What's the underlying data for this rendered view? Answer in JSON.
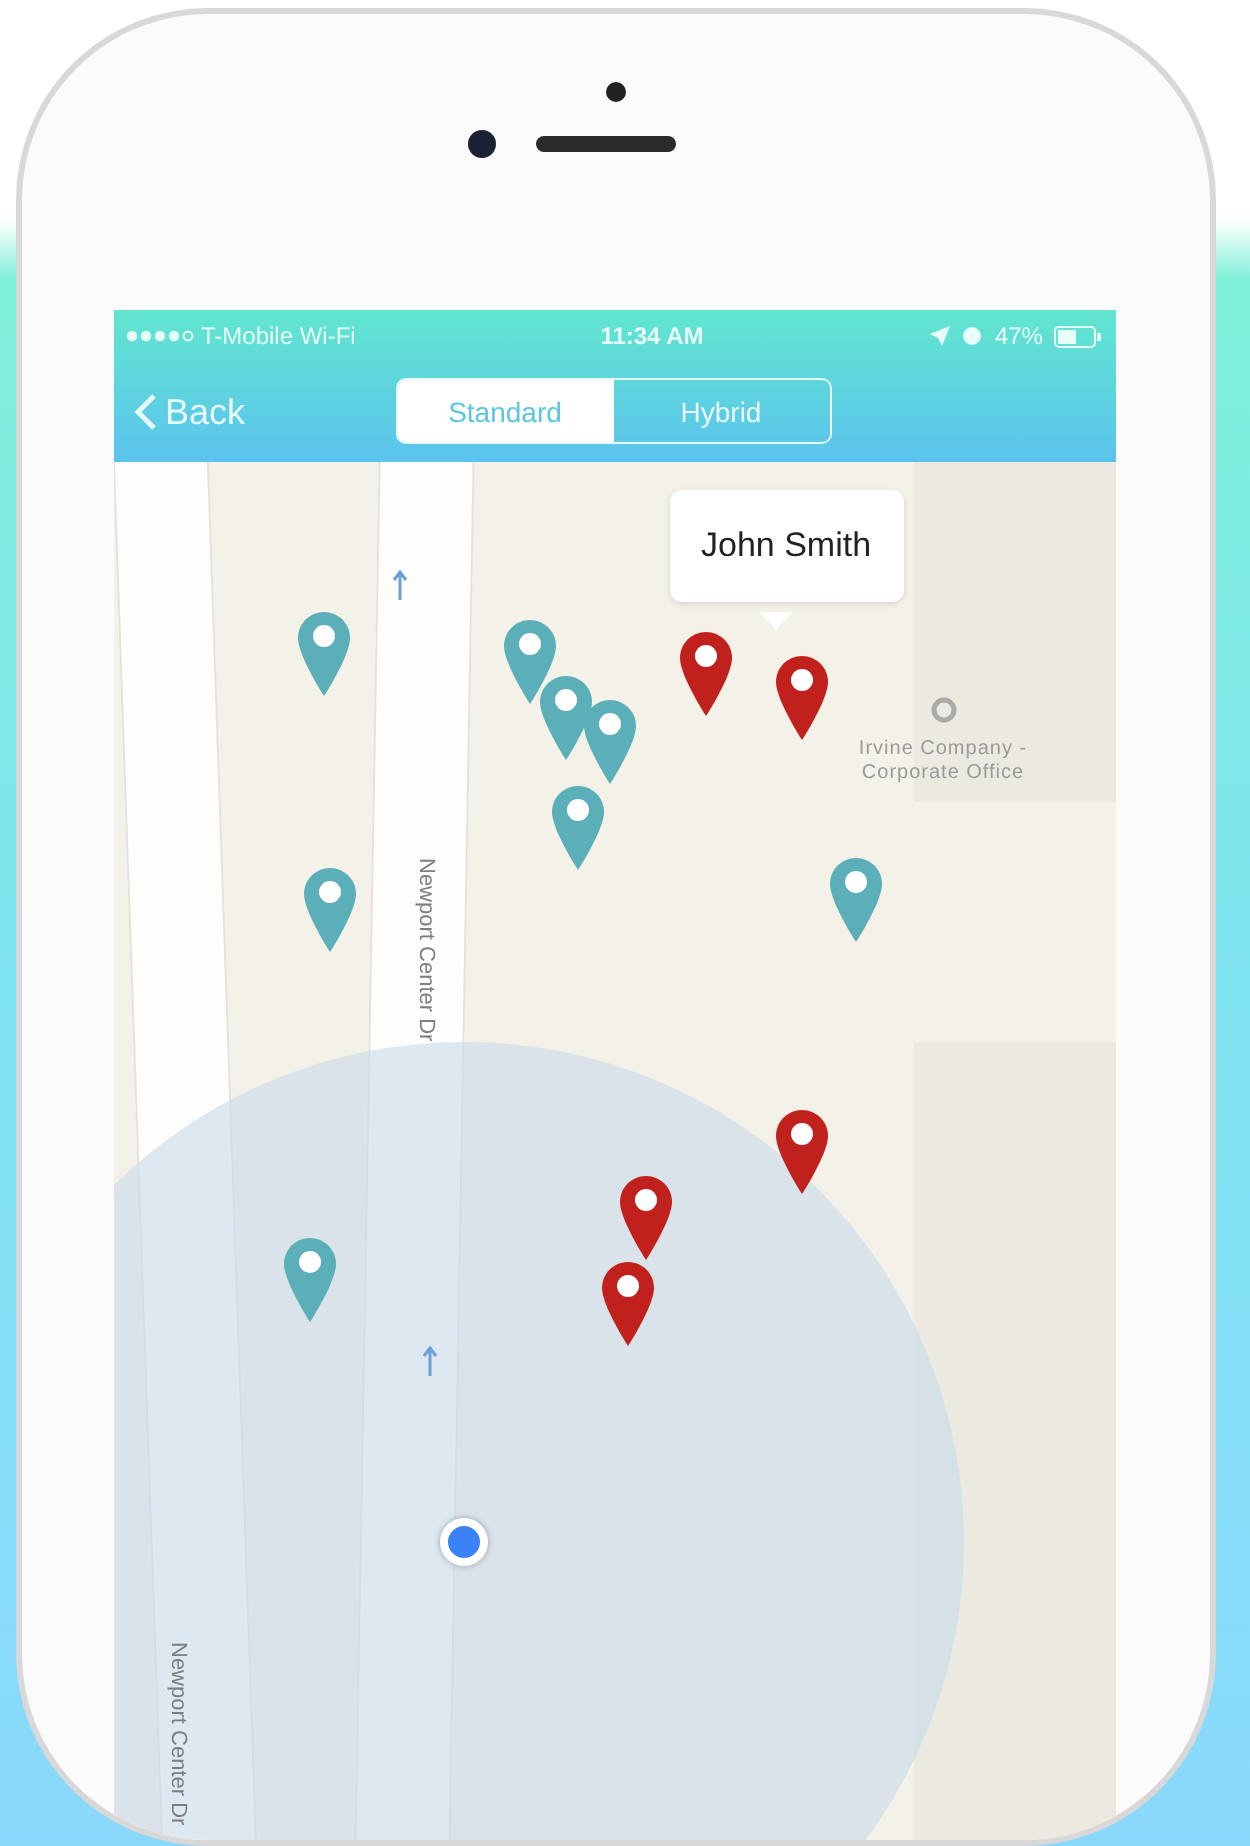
{
  "status_bar": {
    "carrier": "T-Mobile Wi-Fi",
    "time": "11:34 AM",
    "battery": "47%"
  },
  "nav": {
    "back": "Back",
    "segments": [
      {
        "label": "Standard",
        "selected": true
      },
      {
        "label": "Hybrid",
        "selected": false
      }
    ]
  },
  "map": {
    "streets": [
      "Newport Center Dr",
      "Newport Center Dr"
    ],
    "place": "Irvine Company - Corporate Office",
    "callout": "John Smith",
    "pins": [
      {
        "color": "#5aafb8"
      },
      {
        "color": "#5aafb8"
      },
      {
        "color": "#5aafb8"
      },
      {
        "color": "#5aafb8"
      },
      {
        "color": "#5aafb8"
      },
      {
        "color": "#5aafb8"
      },
      {
        "color": "#5aafb8"
      },
      {
        "color": "#5aafb8"
      },
      {
        "color": "#c0211c"
      },
      {
        "color": "#c0211c"
      },
      {
        "color": "#c0211c"
      },
      {
        "color": "#c0211c"
      },
      {
        "color": "#c0211c"
      }
    ]
  }
}
